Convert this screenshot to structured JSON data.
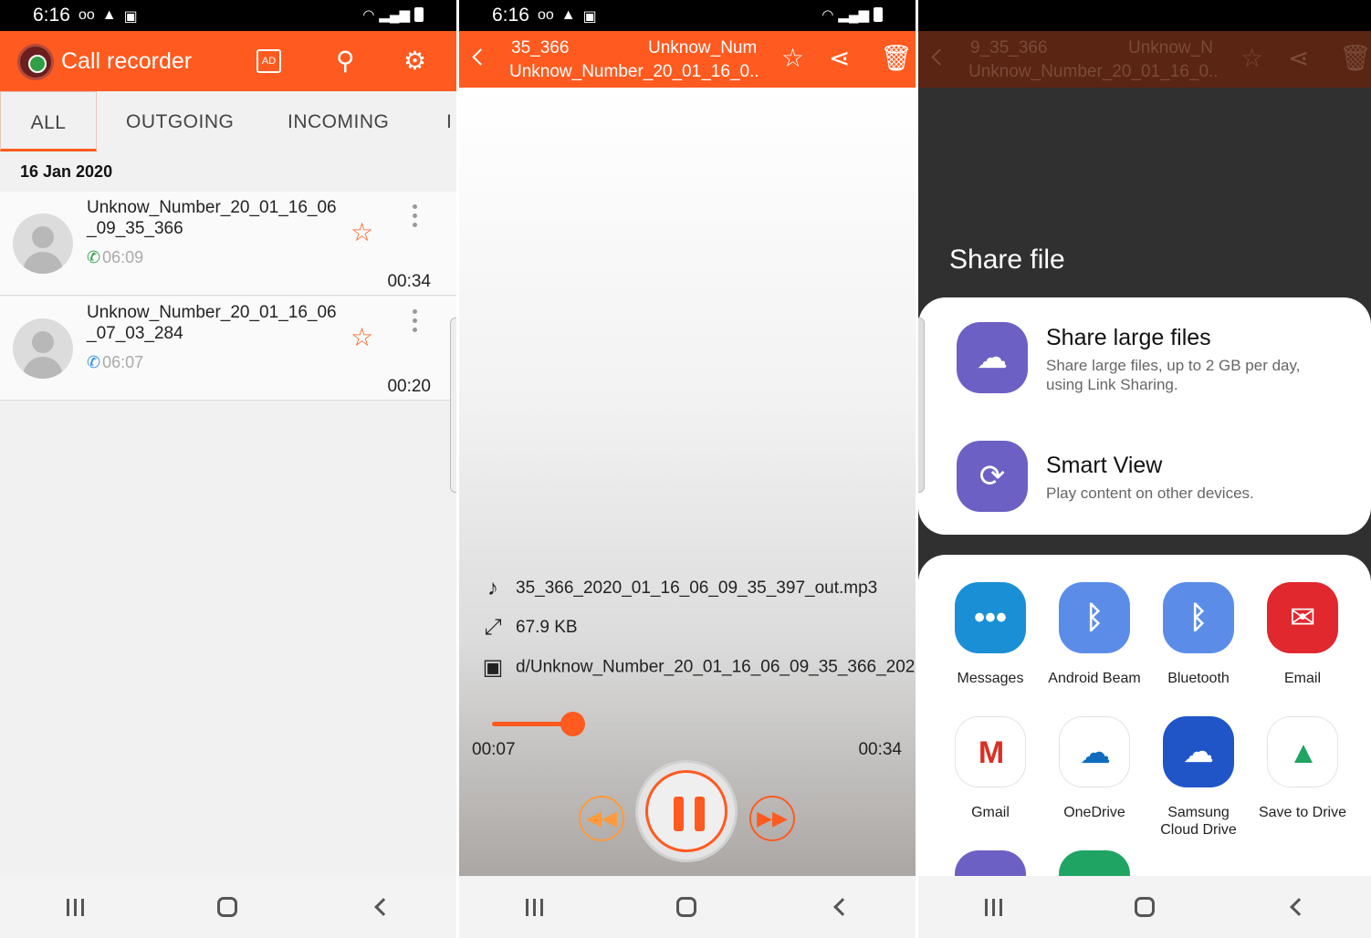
{
  "status_bar": {
    "time": "6:16"
  },
  "panel1": {
    "app_title": "Call recorder",
    "toolbar": {
      "ad_label": "AD"
    },
    "tabs": [
      "ALL",
      "OUTGOING",
      "INCOMING",
      "I"
    ],
    "date_header": "16 Jan 2020",
    "recordings": [
      {
        "name": "Unknow_Number_20_01_16_06_09_35_366",
        "time": "06:09",
        "duration": "00:34",
        "direction": "outgoing"
      },
      {
        "name": "Unknow_Number_20_01_16_06_07_03_284",
        "time": "06:07",
        "duration": "00:20",
        "direction": "incoming"
      }
    ]
  },
  "panel2": {
    "title_line1_a": "35_366",
    "title_line1_b": "Unknow_Num",
    "title_line2": "Unknow_Number_20_01_16_0..",
    "file_name": "35_366_2020_01_16_06_09_35_397_out.mp3",
    "file_size": "67.9 KB",
    "file_path": "d/Unknow_Number_20_01_16_06_09_35_366_202",
    "current_time": "00:07",
    "total_time": "00:34",
    "progress": 0.206
  },
  "panel3": {
    "title_line1_a": "9_35_366",
    "title_line1_b": "Unknow_N",
    "title_line2": "Unknow_Number_20_01_16_0..",
    "share_title": "Share file",
    "options": [
      {
        "title": "Share large files",
        "subtitle": "Share large files, up to 2 GB per day, using Link Sharing."
      },
      {
        "title": "Smart View",
        "subtitle": "Play content on other devices."
      }
    ],
    "apps": [
      {
        "label": "Messages",
        "color": "#1a8fd6"
      },
      {
        "label": "Android Beam",
        "color": "#5b8de8"
      },
      {
        "label": "Bluetooth",
        "color": "#5b8de8"
      },
      {
        "label": "Email",
        "color": "#e0282e"
      },
      {
        "label": "Gmail",
        "color": "#ffffff"
      },
      {
        "label": "OneDrive",
        "color": "#ffffff"
      },
      {
        "label": "Samsung Cloud Drive",
        "color": "#2055c8"
      },
      {
        "label": "Save to Drive",
        "color": "#ffffff"
      }
    ]
  }
}
